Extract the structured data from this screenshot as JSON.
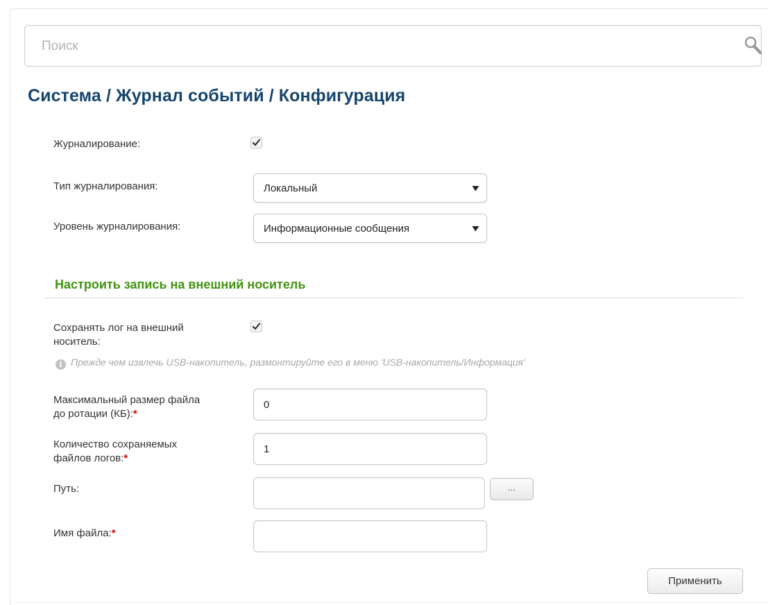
{
  "search": {
    "placeholder": "Поиск",
    "icon": "search-icon"
  },
  "breadcrumb": {
    "text": "Система /  Журнал событий /  Конфигурация"
  },
  "logging": {
    "enabled_label": "Журналирование:",
    "enabled": true,
    "type_label": "Тип журналирования:",
    "type_value": "Локальный",
    "level_label": "Уровень журналирования:",
    "level_value": "Информационные сообщения"
  },
  "external": {
    "section_title": "Настроить запись на внешний носитель",
    "save_label_line1": "Сохранять лог на внешний",
    "save_label_line2": "носитель:",
    "save_enabled": true,
    "info_note": "Прежде чем извлечь USB-накопитель, размонтируйте его в меню 'USB-накопитель/Информация'",
    "max_size_label_line1": "Максимальный размер файла",
    "max_size_label_line2": "до ротации (КБ):",
    "max_size_value": "0",
    "count_label_line1": "Количество сохраняемых",
    "count_label_line2": "файлов логов:",
    "count_value": "1",
    "path_label": "Путь:",
    "path_value": "",
    "browse_label": "...",
    "filename_label": "Имя файла:",
    "filename_value": "",
    "required_mark": "*"
  },
  "actions": {
    "apply_label": "Применить"
  },
  "colors": {
    "title": "#16456e",
    "section_title": "#42930f",
    "required": "#d60000",
    "info_text": "#a8a8a8"
  }
}
